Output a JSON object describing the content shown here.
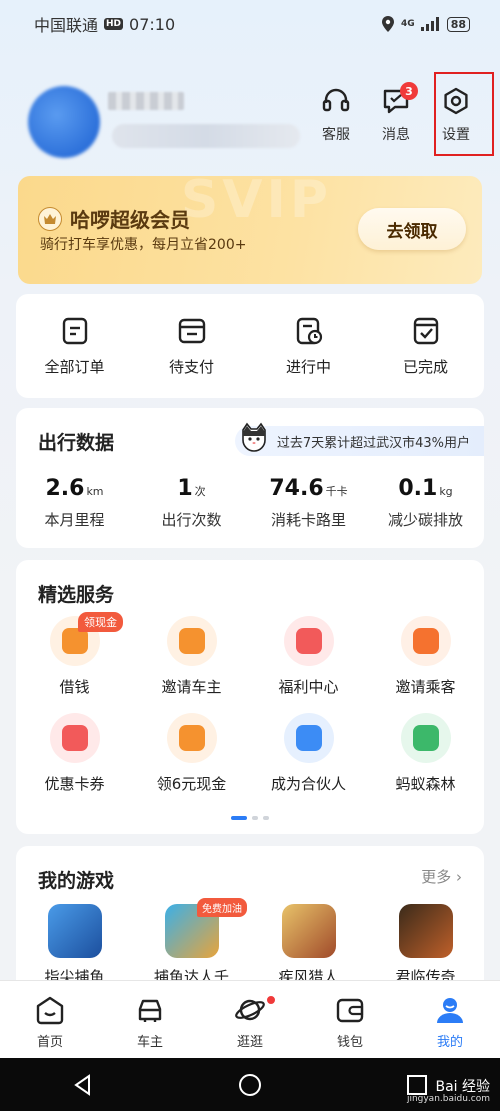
{
  "status_bar": {
    "carrier": "中国联通",
    "hd": "HD",
    "time": "07:10",
    "network": "4G",
    "battery": "88"
  },
  "header": {
    "actions": [
      {
        "label": "客服",
        "icon": "headset-icon"
      },
      {
        "label": "消息",
        "icon": "message-icon",
        "badge": "3"
      },
      {
        "label": "设置",
        "icon": "settings-icon"
      }
    ]
  },
  "vip": {
    "title": "哈啰超级会员",
    "subtitle": "骑行打车享优惠，每月立省200+",
    "button": "去领取"
  },
  "orders": [
    {
      "label": "全部订单",
      "icon": "all-orders-icon"
    },
    {
      "label": "待支付",
      "icon": "pending-payment-icon"
    },
    {
      "label": "进行中",
      "icon": "in-progress-icon"
    },
    {
      "label": "已完成",
      "icon": "completed-icon"
    }
  ],
  "stats": {
    "title": "出行数据",
    "tip": "过去7天累计超过武汉市43%用户",
    "items": [
      {
        "value": "2.6",
        "unit": "km",
        "label": "本月里程"
      },
      {
        "value": "1",
        "unit": "次",
        "label": "出行次数"
      },
      {
        "value": "74.6",
        "unit": "千卡",
        "label": "消耗卡路里"
      },
      {
        "value": "0.1",
        "unit": "kg",
        "label": "减少碳排放"
      }
    ]
  },
  "services": {
    "title": "精选服务",
    "items": [
      {
        "label": "借钱",
        "badge": "领现金",
        "icon": "borrow-money-icon",
        "color": "#f5922f",
        "bg": "#fff1e3"
      },
      {
        "label": "邀请车主",
        "icon": "invite-driver-icon",
        "color": "#f5922f",
        "bg": "#fff1e3"
      },
      {
        "label": "福利中心",
        "icon": "gift-icon",
        "color": "#f25a5a",
        "bg": "#ffe9e9"
      },
      {
        "label": "邀请乘客",
        "icon": "invite-passenger-icon",
        "color": "#f5722f",
        "bg": "#fff0e6"
      },
      {
        "label": "优惠卡券",
        "icon": "coupon-icon",
        "color": "#f25a5a",
        "bg": "#ffe9e9"
      },
      {
        "label": "领6元现金",
        "icon": "cash-icon",
        "color": "#f5922f",
        "bg": "#fff1e3"
      },
      {
        "label": "成为合伙人",
        "icon": "partner-icon",
        "color": "#3c8cf5",
        "bg": "#e6f0fe"
      },
      {
        "label": "蚂蚁森林",
        "icon": "leaf-icon",
        "color": "#3cb86a",
        "bg": "#e6f7ec"
      }
    ]
  },
  "games": {
    "title": "我的游戏",
    "more": "更多",
    "items": [
      {
        "label": "指尖捕鱼",
        "colors": [
          "#4a9be8",
          "#1c4f9e"
        ]
      },
      {
        "label": "捕鱼达人千",
        "badge": "免费加油",
        "colors": [
          "#3bb0e8",
          "#e8a43b"
        ]
      },
      {
        "label": "疾风猎人",
        "colors": [
          "#e8c36a",
          "#a04a2a"
        ]
      },
      {
        "label": "君临传奇",
        "colors": [
          "#3a2a1a",
          "#c0602a"
        ]
      }
    ]
  },
  "bottom_nav": [
    {
      "label": "首页",
      "icon": "home-icon"
    },
    {
      "label": "车主",
      "icon": "car-icon"
    },
    {
      "label": "逛逛",
      "icon": "planet-icon"
    },
    {
      "label": "钱包",
      "icon": "wallet-icon"
    },
    {
      "label": "我的",
      "icon": "profile-icon",
      "active": true
    }
  ],
  "watermark": {
    "main": "Bai 经验",
    "sub": "jingyan.baidu.com"
  }
}
